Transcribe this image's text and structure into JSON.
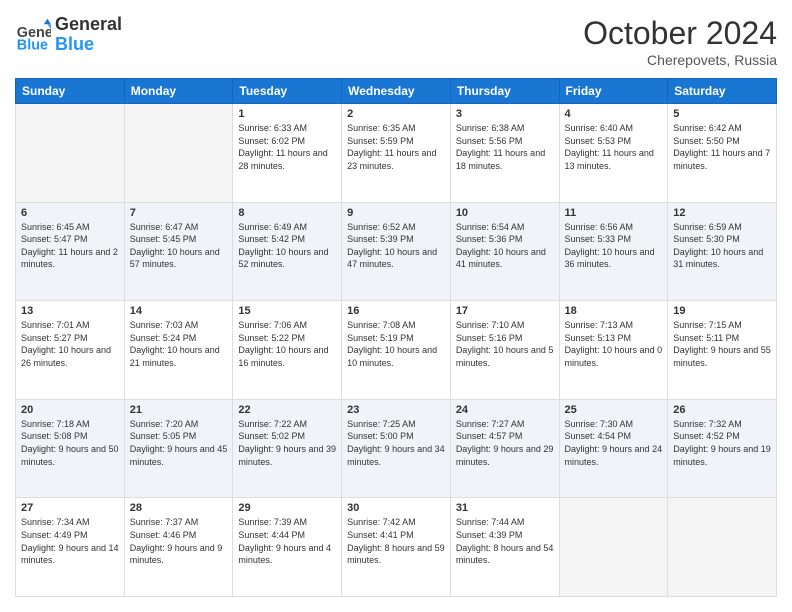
{
  "header": {
    "logo_general": "General",
    "logo_blue": "Blue",
    "month": "October 2024",
    "location": "Cherepovets, Russia"
  },
  "weekdays": [
    "Sunday",
    "Monday",
    "Tuesday",
    "Wednesday",
    "Thursday",
    "Friday",
    "Saturday"
  ],
  "weeks": [
    [
      {
        "day": "",
        "sunrise": "",
        "sunset": "",
        "daylight": ""
      },
      {
        "day": "",
        "sunrise": "",
        "sunset": "",
        "daylight": ""
      },
      {
        "day": "1",
        "sunrise": "Sunrise: 6:33 AM",
        "sunset": "Sunset: 6:02 PM",
        "daylight": "Daylight: 11 hours and 28 minutes."
      },
      {
        "day": "2",
        "sunrise": "Sunrise: 6:35 AM",
        "sunset": "Sunset: 5:59 PM",
        "daylight": "Daylight: 11 hours and 23 minutes."
      },
      {
        "day": "3",
        "sunrise": "Sunrise: 6:38 AM",
        "sunset": "Sunset: 5:56 PM",
        "daylight": "Daylight: 11 hours and 18 minutes."
      },
      {
        "day": "4",
        "sunrise": "Sunrise: 6:40 AM",
        "sunset": "Sunset: 5:53 PM",
        "daylight": "Daylight: 11 hours and 13 minutes."
      },
      {
        "day": "5",
        "sunrise": "Sunrise: 6:42 AM",
        "sunset": "Sunset: 5:50 PM",
        "daylight": "Daylight: 11 hours and 7 minutes."
      }
    ],
    [
      {
        "day": "6",
        "sunrise": "Sunrise: 6:45 AM",
        "sunset": "Sunset: 5:47 PM",
        "daylight": "Daylight: 11 hours and 2 minutes."
      },
      {
        "day": "7",
        "sunrise": "Sunrise: 6:47 AM",
        "sunset": "Sunset: 5:45 PM",
        "daylight": "Daylight: 10 hours and 57 minutes."
      },
      {
        "day": "8",
        "sunrise": "Sunrise: 6:49 AM",
        "sunset": "Sunset: 5:42 PM",
        "daylight": "Daylight: 10 hours and 52 minutes."
      },
      {
        "day": "9",
        "sunrise": "Sunrise: 6:52 AM",
        "sunset": "Sunset: 5:39 PM",
        "daylight": "Daylight: 10 hours and 47 minutes."
      },
      {
        "day": "10",
        "sunrise": "Sunrise: 6:54 AM",
        "sunset": "Sunset: 5:36 PM",
        "daylight": "Daylight: 10 hours and 41 minutes."
      },
      {
        "day": "11",
        "sunrise": "Sunrise: 6:56 AM",
        "sunset": "Sunset: 5:33 PM",
        "daylight": "Daylight: 10 hours and 36 minutes."
      },
      {
        "day": "12",
        "sunrise": "Sunrise: 6:59 AM",
        "sunset": "Sunset: 5:30 PM",
        "daylight": "Daylight: 10 hours and 31 minutes."
      }
    ],
    [
      {
        "day": "13",
        "sunrise": "Sunrise: 7:01 AM",
        "sunset": "Sunset: 5:27 PM",
        "daylight": "Daylight: 10 hours and 26 minutes."
      },
      {
        "day": "14",
        "sunrise": "Sunrise: 7:03 AM",
        "sunset": "Sunset: 5:24 PM",
        "daylight": "Daylight: 10 hours and 21 minutes."
      },
      {
        "day": "15",
        "sunrise": "Sunrise: 7:06 AM",
        "sunset": "Sunset: 5:22 PM",
        "daylight": "Daylight: 10 hours and 16 minutes."
      },
      {
        "day": "16",
        "sunrise": "Sunrise: 7:08 AM",
        "sunset": "Sunset: 5:19 PM",
        "daylight": "Daylight: 10 hours and 10 minutes."
      },
      {
        "day": "17",
        "sunrise": "Sunrise: 7:10 AM",
        "sunset": "Sunset: 5:16 PM",
        "daylight": "Daylight: 10 hours and 5 minutes."
      },
      {
        "day": "18",
        "sunrise": "Sunrise: 7:13 AM",
        "sunset": "Sunset: 5:13 PM",
        "daylight": "Daylight: 10 hours and 0 minutes."
      },
      {
        "day": "19",
        "sunrise": "Sunrise: 7:15 AM",
        "sunset": "Sunset: 5:11 PM",
        "daylight": "Daylight: 9 hours and 55 minutes."
      }
    ],
    [
      {
        "day": "20",
        "sunrise": "Sunrise: 7:18 AM",
        "sunset": "Sunset: 5:08 PM",
        "daylight": "Daylight: 9 hours and 50 minutes."
      },
      {
        "day": "21",
        "sunrise": "Sunrise: 7:20 AM",
        "sunset": "Sunset: 5:05 PM",
        "daylight": "Daylight: 9 hours and 45 minutes."
      },
      {
        "day": "22",
        "sunrise": "Sunrise: 7:22 AM",
        "sunset": "Sunset: 5:02 PM",
        "daylight": "Daylight: 9 hours and 39 minutes."
      },
      {
        "day": "23",
        "sunrise": "Sunrise: 7:25 AM",
        "sunset": "Sunset: 5:00 PM",
        "daylight": "Daylight: 9 hours and 34 minutes."
      },
      {
        "day": "24",
        "sunrise": "Sunrise: 7:27 AM",
        "sunset": "Sunset: 4:57 PM",
        "daylight": "Daylight: 9 hours and 29 minutes."
      },
      {
        "day": "25",
        "sunrise": "Sunrise: 7:30 AM",
        "sunset": "Sunset: 4:54 PM",
        "daylight": "Daylight: 9 hours and 24 minutes."
      },
      {
        "day": "26",
        "sunrise": "Sunrise: 7:32 AM",
        "sunset": "Sunset: 4:52 PM",
        "daylight": "Daylight: 9 hours and 19 minutes."
      }
    ],
    [
      {
        "day": "27",
        "sunrise": "Sunrise: 7:34 AM",
        "sunset": "Sunset: 4:49 PM",
        "daylight": "Daylight: 9 hours and 14 minutes."
      },
      {
        "day": "28",
        "sunrise": "Sunrise: 7:37 AM",
        "sunset": "Sunset: 4:46 PM",
        "daylight": "Daylight: 9 hours and 9 minutes."
      },
      {
        "day": "29",
        "sunrise": "Sunrise: 7:39 AM",
        "sunset": "Sunset: 4:44 PM",
        "daylight": "Daylight: 9 hours and 4 minutes."
      },
      {
        "day": "30",
        "sunrise": "Sunrise: 7:42 AM",
        "sunset": "Sunset: 4:41 PM",
        "daylight": "Daylight: 8 hours and 59 minutes."
      },
      {
        "day": "31",
        "sunrise": "Sunrise: 7:44 AM",
        "sunset": "Sunset: 4:39 PM",
        "daylight": "Daylight: 8 hours and 54 minutes."
      },
      {
        "day": "",
        "sunrise": "",
        "sunset": "",
        "daylight": ""
      },
      {
        "day": "",
        "sunrise": "",
        "sunset": "",
        "daylight": ""
      }
    ]
  ]
}
